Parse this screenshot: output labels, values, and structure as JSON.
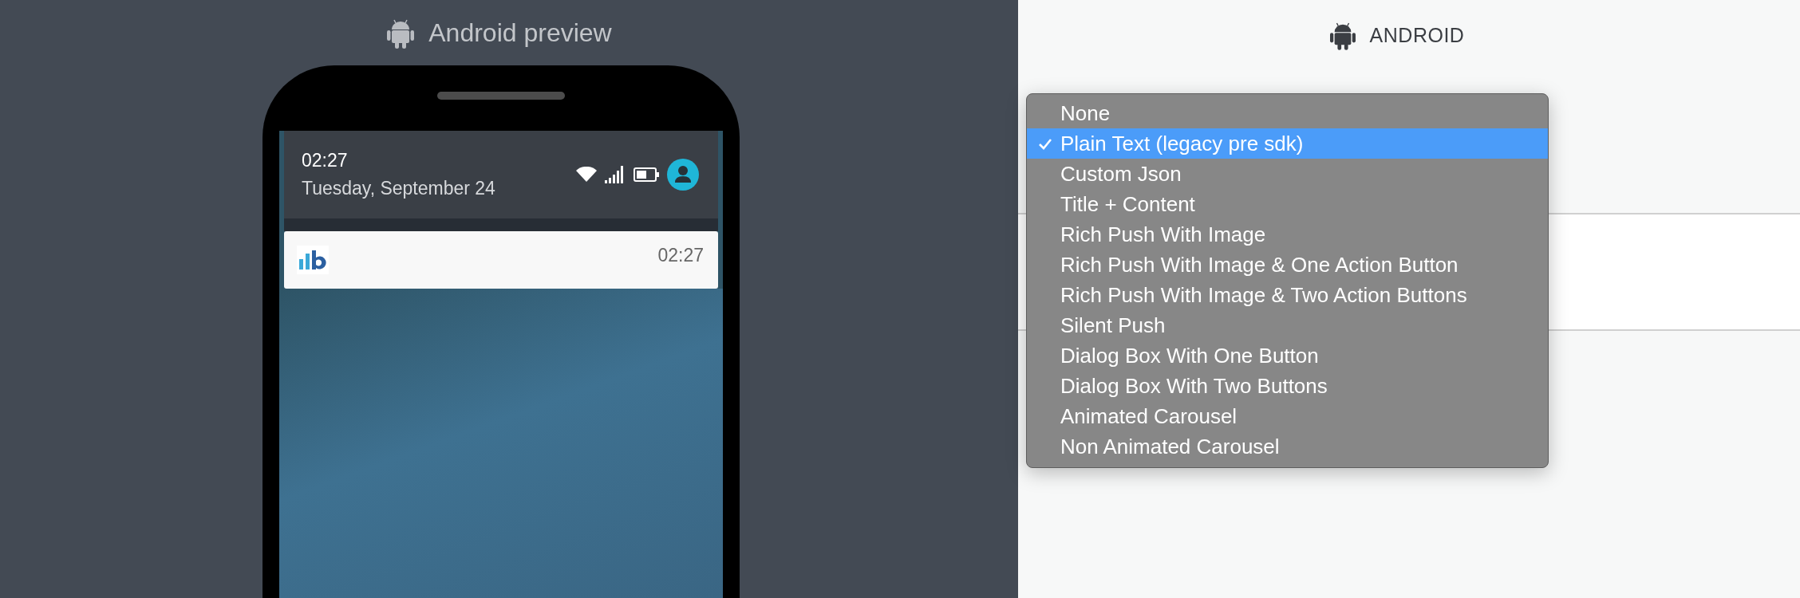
{
  "preview_panel": {
    "title": "Android preview"
  },
  "phone": {
    "status_time": "02:27",
    "status_date": "Tuesday, September 24",
    "notification": {
      "time": "02:27"
    }
  },
  "settings_panel": {
    "title": "ANDROID"
  },
  "dropdown": {
    "options": [
      {
        "label": "None",
        "selected": false
      },
      {
        "label": "Plain Text (legacy pre sdk)",
        "selected": true
      },
      {
        "label": "Custom Json",
        "selected": false
      },
      {
        "label": "Title + Content",
        "selected": false
      },
      {
        "label": "Rich Push With Image",
        "selected": false
      },
      {
        "label": "Rich Push With Image & One Action Button",
        "selected": false
      },
      {
        "label": "Rich Push With Image & Two Action Buttons",
        "selected": false
      },
      {
        "label": "Silent Push",
        "selected": false
      },
      {
        "label": "Dialog Box With One Button",
        "selected": false
      },
      {
        "label": "Dialog Box With Two Buttons",
        "selected": false
      },
      {
        "label": "Animated Carousel",
        "selected": false
      },
      {
        "label": "Non Animated Carousel",
        "selected": false
      }
    ]
  }
}
